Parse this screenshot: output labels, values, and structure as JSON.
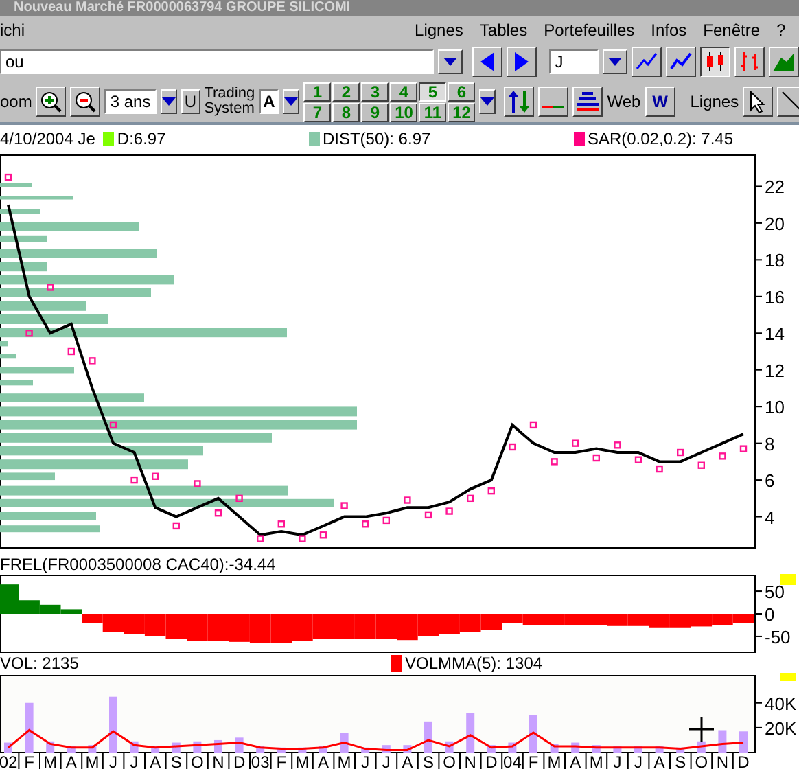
{
  "window": {
    "title": "Nouveau Marché   FR0000063794   GROUPE SILICOMI"
  },
  "menu": [
    "ichi",
    "Lignes",
    "Tables",
    "Portefeuilles",
    "Infos",
    "Fenêtre",
    "?"
  ],
  "toolbar": {
    "search_value": "ou",
    "period_value": "J",
    "zoom_label": "oom",
    "range_value": "3 ans",
    "u_button": "U",
    "trading_system_label": "Trading System",
    "system_value": "A",
    "presets": [
      {
        "label": "1",
        "selected": false
      },
      {
        "label": "2",
        "selected": false
      },
      {
        "label": "3",
        "selected": false
      },
      {
        "label": "4",
        "selected": false
      },
      {
        "label": "5",
        "selected": true
      },
      {
        "label": "6",
        "selected": false
      },
      {
        "label": "7",
        "selected": false
      },
      {
        "label": "8",
        "selected": false
      },
      {
        "label": "9",
        "selected": false
      },
      {
        "label": "10",
        "selected": false
      },
      {
        "label": "11",
        "selected": false
      },
      {
        "label": "12",
        "selected": false
      }
    ],
    "chart_types": [
      {
        "kind": "line",
        "selected": false
      },
      {
        "kind": "points",
        "selected": false
      },
      {
        "kind": "candles",
        "selected": true
      },
      {
        "kind": "bars",
        "selected": false
      },
      {
        "kind": "mountain",
        "selected": false
      }
    ],
    "web_label": "Web",
    "web_button": "W",
    "lines_label": "Lignes"
  },
  "info": {
    "date": "4/10/2004 Je",
    "items": [
      {
        "label": "D:6.97",
        "color": "#80ff00"
      },
      {
        "label": "DIST(50):  6.97",
        "color": "#88c8a8"
      },
      {
        "label": "SAR(0.02,0.2):  7.45",
        "color": "#ff0080"
      }
    ]
  },
  "price_chart": {
    "chart_data": {
      "type": "line",
      "ylim": [
        2.3,
        23.7
      ],
      "yticks": [
        4,
        6,
        8,
        10,
        12,
        14,
        16,
        18,
        20,
        22
      ],
      "series": [
        {
          "color": "#000000",
          "values": [
            21,
            16,
            14,
            14.5,
            11,
            8,
            7.5,
            4.5,
            4,
            4.5,
            5,
            4,
            3,
            3.2,
            3,
            3.5,
            4,
            4,
            4.2,
            4.5,
            4.5,
            4.8,
            5.5,
            6,
            9,
            8,
            7.5,
            7.5,
            7.7,
            7.5,
            7.5,
            7,
            7,
            7.5,
            8,
            8.5
          ]
        },
        {
          "type": "scatter",
          "color": "#ff1493",
          "values": [
            22.5,
            14,
            16.5,
            13,
            12.5,
            9,
            6,
            6.2,
            3.5,
            5.8,
            4.2,
            5,
            2.8,
            3.6,
            2.8,
            3,
            4.6,
            3.6,
            3.8,
            4.9,
            4.1,
            4.3,
            5,
            5.4,
            7.8,
            9,
            7,
            8,
            7.2,
            7.9,
            7.1,
            6.6,
            7.5,
            6.8,
            7.3,
            7.7
          ]
        }
      ]
    }
  },
  "frel": {
    "label": "FREL(FR0003500008  CAC40):-34.44",
    "chart_data": {
      "type": "bar",
      "ylim": [
        -85,
        85
      ],
      "yticks": [
        -50,
        0,
        50
      ],
      "series": [
        {
          "color": "#008000",
          "values": [
            65,
            30,
            20,
            10,
            null,
            null,
            null,
            null,
            null,
            null,
            null,
            null,
            null,
            null,
            null,
            null,
            null,
            null,
            null,
            null,
            null,
            null,
            null,
            null,
            null,
            null,
            null,
            null,
            null,
            null,
            null,
            null,
            null,
            null,
            null,
            null
          ]
        },
        {
          "color": "#ff0000",
          "values": [
            null,
            null,
            null,
            null,
            -20,
            -40,
            -45,
            -50,
            -55,
            -60,
            -60,
            -62,
            -65,
            -65,
            -60,
            -55,
            -55,
            -55,
            -55,
            -58,
            -50,
            -45,
            -40,
            -35,
            -20,
            -25,
            -25,
            -25,
            -25,
            -27,
            -27,
            -30,
            -30,
            -28,
            -25,
            -20
          ]
        }
      ]
    }
  },
  "volume": {
    "label": "VOL:  2135",
    "ma_label": "VOLMMA(5):  1304",
    "chart_data": {
      "type": "bar",
      "ylim": [
        0,
        62000
      ],
      "yticks": [
        {
          "value": 20000,
          "label": "20K"
        },
        {
          "value": 40000,
          "label": "40K"
        }
      ],
      "categories": [
        "02",
        "F",
        "M",
        "A",
        "M",
        "J",
        "J",
        "A",
        "S",
        "O",
        "N",
        "D",
        "03",
        "F",
        "M",
        "A",
        "M",
        "J",
        "J",
        "A",
        "S",
        "O",
        "N",
        "D",
        "04",
        "F",
        "M",
        "A",
        "M",
        "J",
        "J",
        "A",
        "S",
        "O",
        "N",
        "D"
      ],
      "series": [
        {
          "color": "#c8a0ff",
          "values": [
            8000,
            40000,
            9000,
            5000,
            6000,
            45000,
            9000,
            5000,
            8000,
            9000,
            10000,
            12000,
            5000,
            4000,
            4000,
            5000,
            16000,
            4000,
            6000,
            6000,
            25000,
            9000,
            32000,
            6000,
            8000,
            30000,
            7000,
            8000,
            6000,
            5000,
            5000,
            5000,
            4000,
            9000,
            18000,
            17000
          ]
        },
        {
          "type": "line",
          "color": "#ff0000",
          "values": [
            4000,
            18000,
            7000,
            4000,
            4000,
            17000,
            6000,
            4000,
            5000,
            6000,
            7000,
            8000,
            4000,
            3000,
            3000,
            4000,
            8000,
            3000,
            2000,
            2000,
            10000,
            5000,
            14000,
            4000,
            5000,
            16000,
            5000,
            5000,
            4000,
            4000,
            4000,
            4000,
            3000,
            5000,
            7000,
            8000
          ]
        }
      ]
    }
  }
}
